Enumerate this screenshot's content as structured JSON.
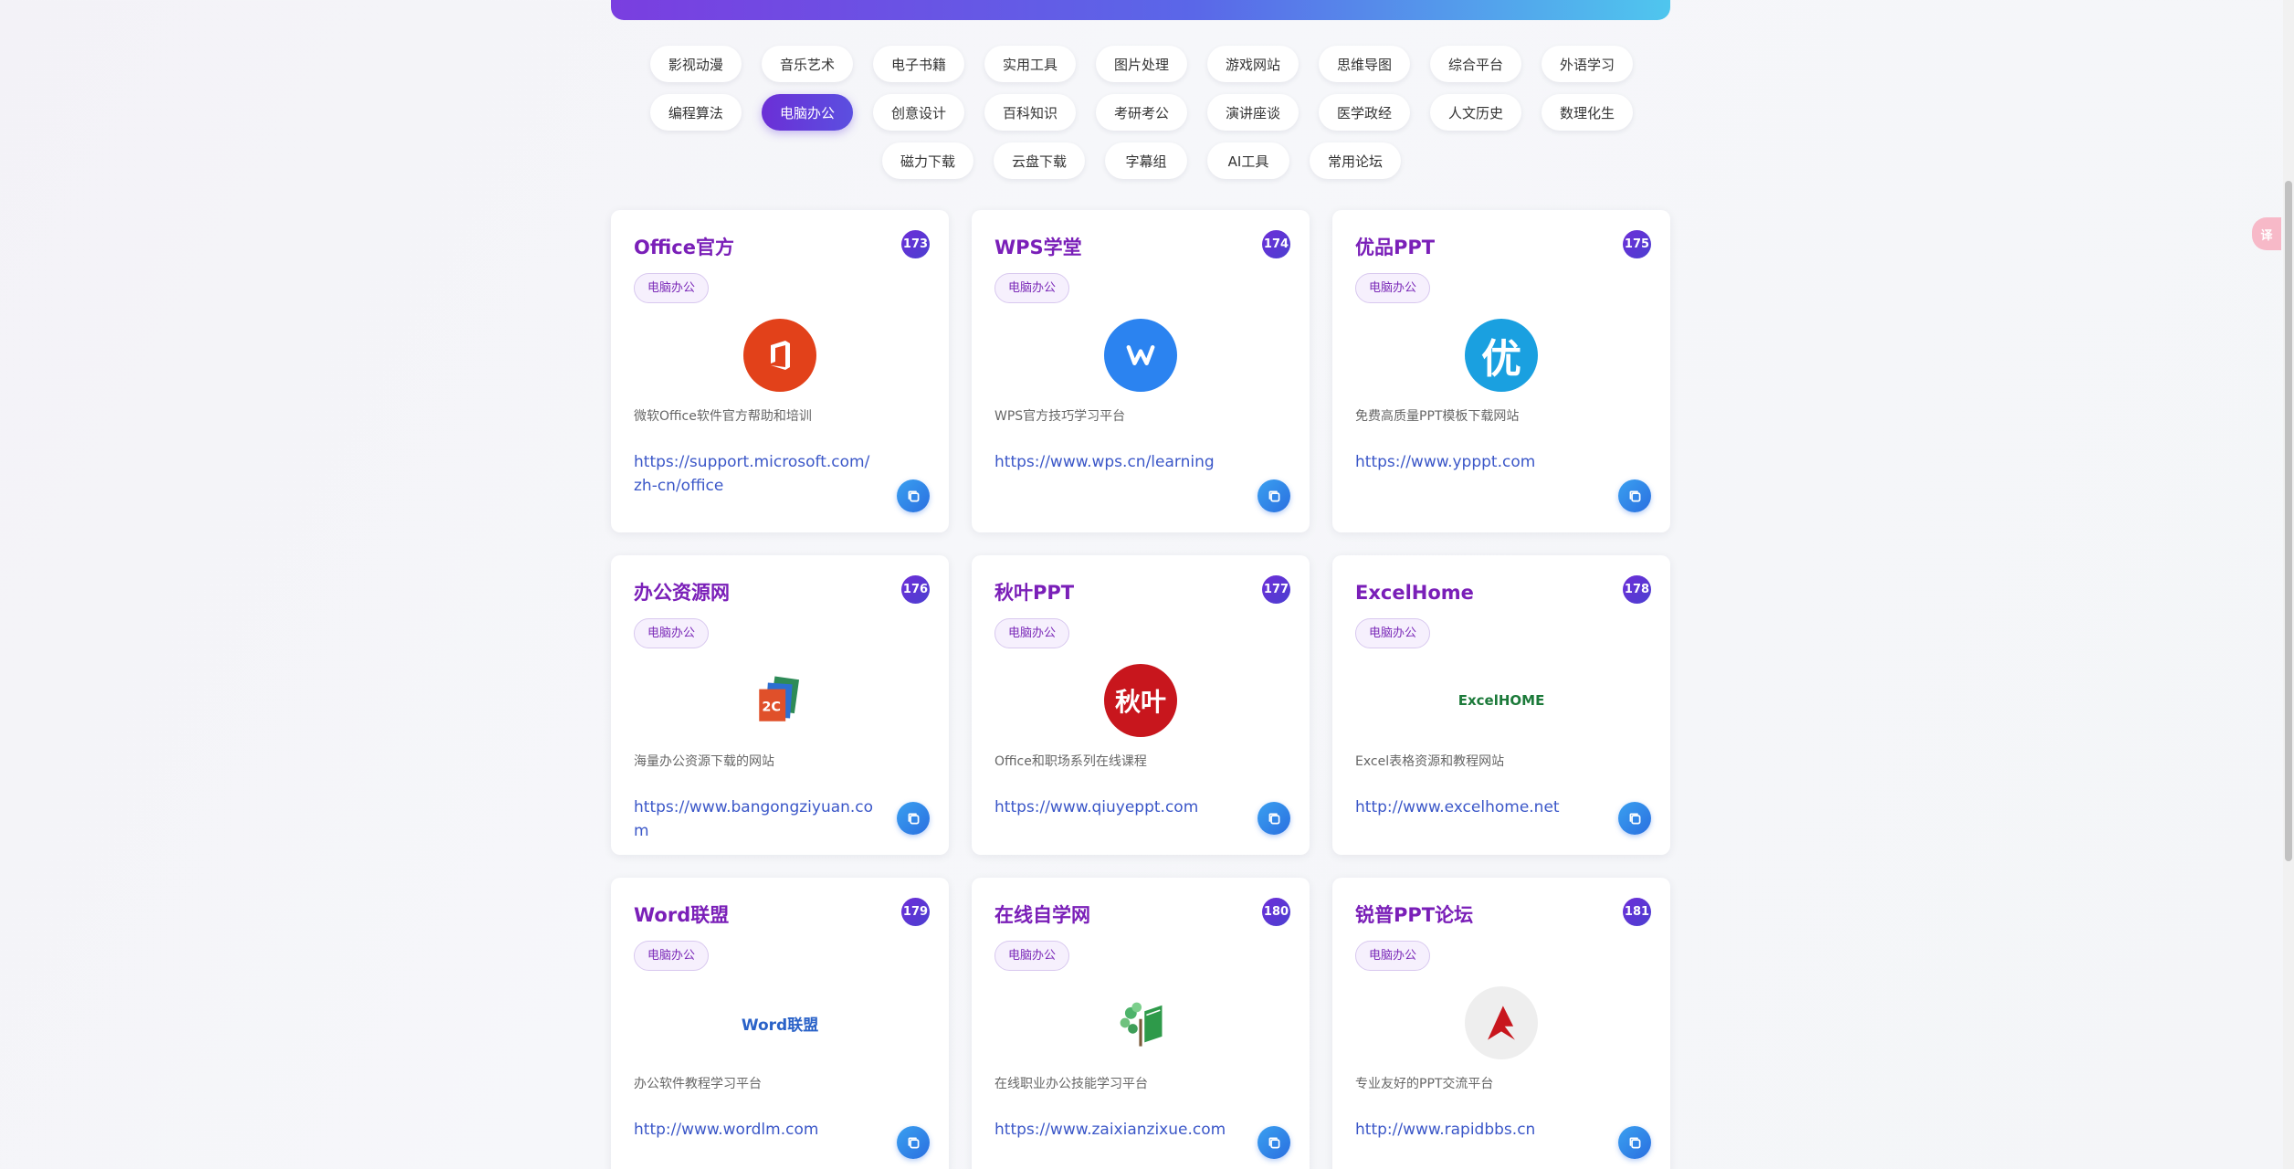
{
  "categories": [
    {
      "label": "影视动漫",
      "active": false
    },
    {
      "label": "音乐艺术",
      "active": false
    },
    {
      "label": "电子书籍",
      "active": false
    },
    {
      "label": "实用工具",
      "active": false
    },
    {
      "label": "图片处理",
      "active": false
    },
    {
      "label": "游戏网站",
      "active": false
    },
    {
      "label": "思维导图",
      "active": false
    },
    {
      "label": "综合平台",
      "active": false
    },
    {
      "label": "外语学习",
      "active": false
    },
    {
      "label": "编程算法",
      "active": false
    },
    {
      "label": "电脑办公",
      "active": true
    },
    {
      "label": "创意设计",
      "active": false
    },
    {
      "label": "百科知识",
      "active": false
    },
    {
      "label": "考研考公",
      "active": false
    },
    {
      "label": "演讲座谈",
      "active": false
    },
    {
      "label": "医学政经",
      "active": false
    },
    {
      "label": "人文历史",
      "active": false
    },
    {
      "label": "数理化生",
      "active": false
    },
    {
      "label": "磁力下载",
      "active": false
    },
    {
      "label": "云盘下载",
      "active": false
    },
    {
      "label": "字幕组",
      "active": false
    },
    {
      "label": "AI工具",
      "active": false
    },
    {
      "label": "常用论坛",
      "active": false
    }
  ],
  "cards": [
    {
      "title": "Office官方",
      "num": "173",
      "tag": "电脑办公",
      "desc": "微软Office软件官方帮助和培训",
      "url": "https://support.microsoft.com/zh-cn/office",
      "logo": {
        "icon": "office-icon",
        "text": "",
        "bg": "#e2411a",
        "fg": "#ffffff"
      }
    },
    {
      "title": "WPS学堂",
      "num": "174",
      "tag": "电脑办公",
      "desc": "WPS官方技巧学习平台",
      "url": "https://www.wps.cn/learning",
      "logo": {
        "icon": "wps-icon",
        "text": "",
        "bg": "#2b83f0",
        "fg": "#ffffff"
      }
    },
    {
      "title": "优品PPT",
      "num": "175",
      "tag": "电脑办公",
      "desc": "免费高质量PPT模板下载网站",
      "url": "https://www.ypppt.com",
      "logo": {
        "icon": "youpin-icon",
        "text": "优",
        "bg": "#1aa0e0",
        "fg": "#ffffff"
      }
    },
    {
      "title": "办公资源网",
      "num": "176",
      "tag": "电脑办公",
      "desc": "海量办公资源下载的网站",
      "url": "https://www.bangongziyuan.com",
      "logo": {
        "icon": "bangong-icon",
        "text": "",
        "bg": "transparent",
        "fg": "#ffffff"
      }
    },
    {
      "title": "秋叶PPT",
      "num": "177",
      "tag": "电脑办公",
      "desc": "Office和职场系列在线课程",
      "url": "https://www.qiuyeppt.com",
      "logo": {
        "icon": "qiuye-icon",
        "text": "秋叶",
        "bg": "#c8161d",
        "fg": "#ffffff"
      }
    },
    {
      "title": "ExcelHome",
      "num": "178",
      "tag": "电脑办公",
      "desc": "Excel表格资源和教程网站",
      "url": "http://www.excelhome.net",
      "logo": {
        "icon": "excelhome-icon",
        "text": "ExcelHOME",
        "bg": "transparent",
        "fg": "#1c7a3a"
      }
    },
    {
      "title": "Word联盟",
      "num": "179",
      "tag": "电脑办公",
      "desc": "办公软件教程学习平台",
      "url": "http://www.wordlm.com",
      "logo": {
        "icon": "wordlm-icon",
        "text": "Word联盟",
        "bg": "transparent",
        "fg": "#2a62c8"
      }
    },
    {
      "title": "在线自学网",
      "num": "180",
      "tag": "电脑办公",
      "desc": "在线职业办公技能学习平台",
      "url": "https://www.zaixianzixue.com",
      "logo": {
        "icon": "tree-book-icon",
        "text": "",
        "bg": "transparent",
        "fg": "#2e9a4a"
      }
    },
    {
      "title": "锐普PPT论坛",
      "num": "181",
      "tag": "电脑办公",
      "desc": "专业友好的PPT交流平台",
      "url": "http://www.rapidbbs.cn",
      "logo": {
        "icon": "rapid-icon",
        "text": "",
        "bg": "#eeeeee",
        "fg": "#c8161d"
      }
    }
  ],
  "float_button": {
    "text": "译",
    "icon": "translate-icon"
  }
}
